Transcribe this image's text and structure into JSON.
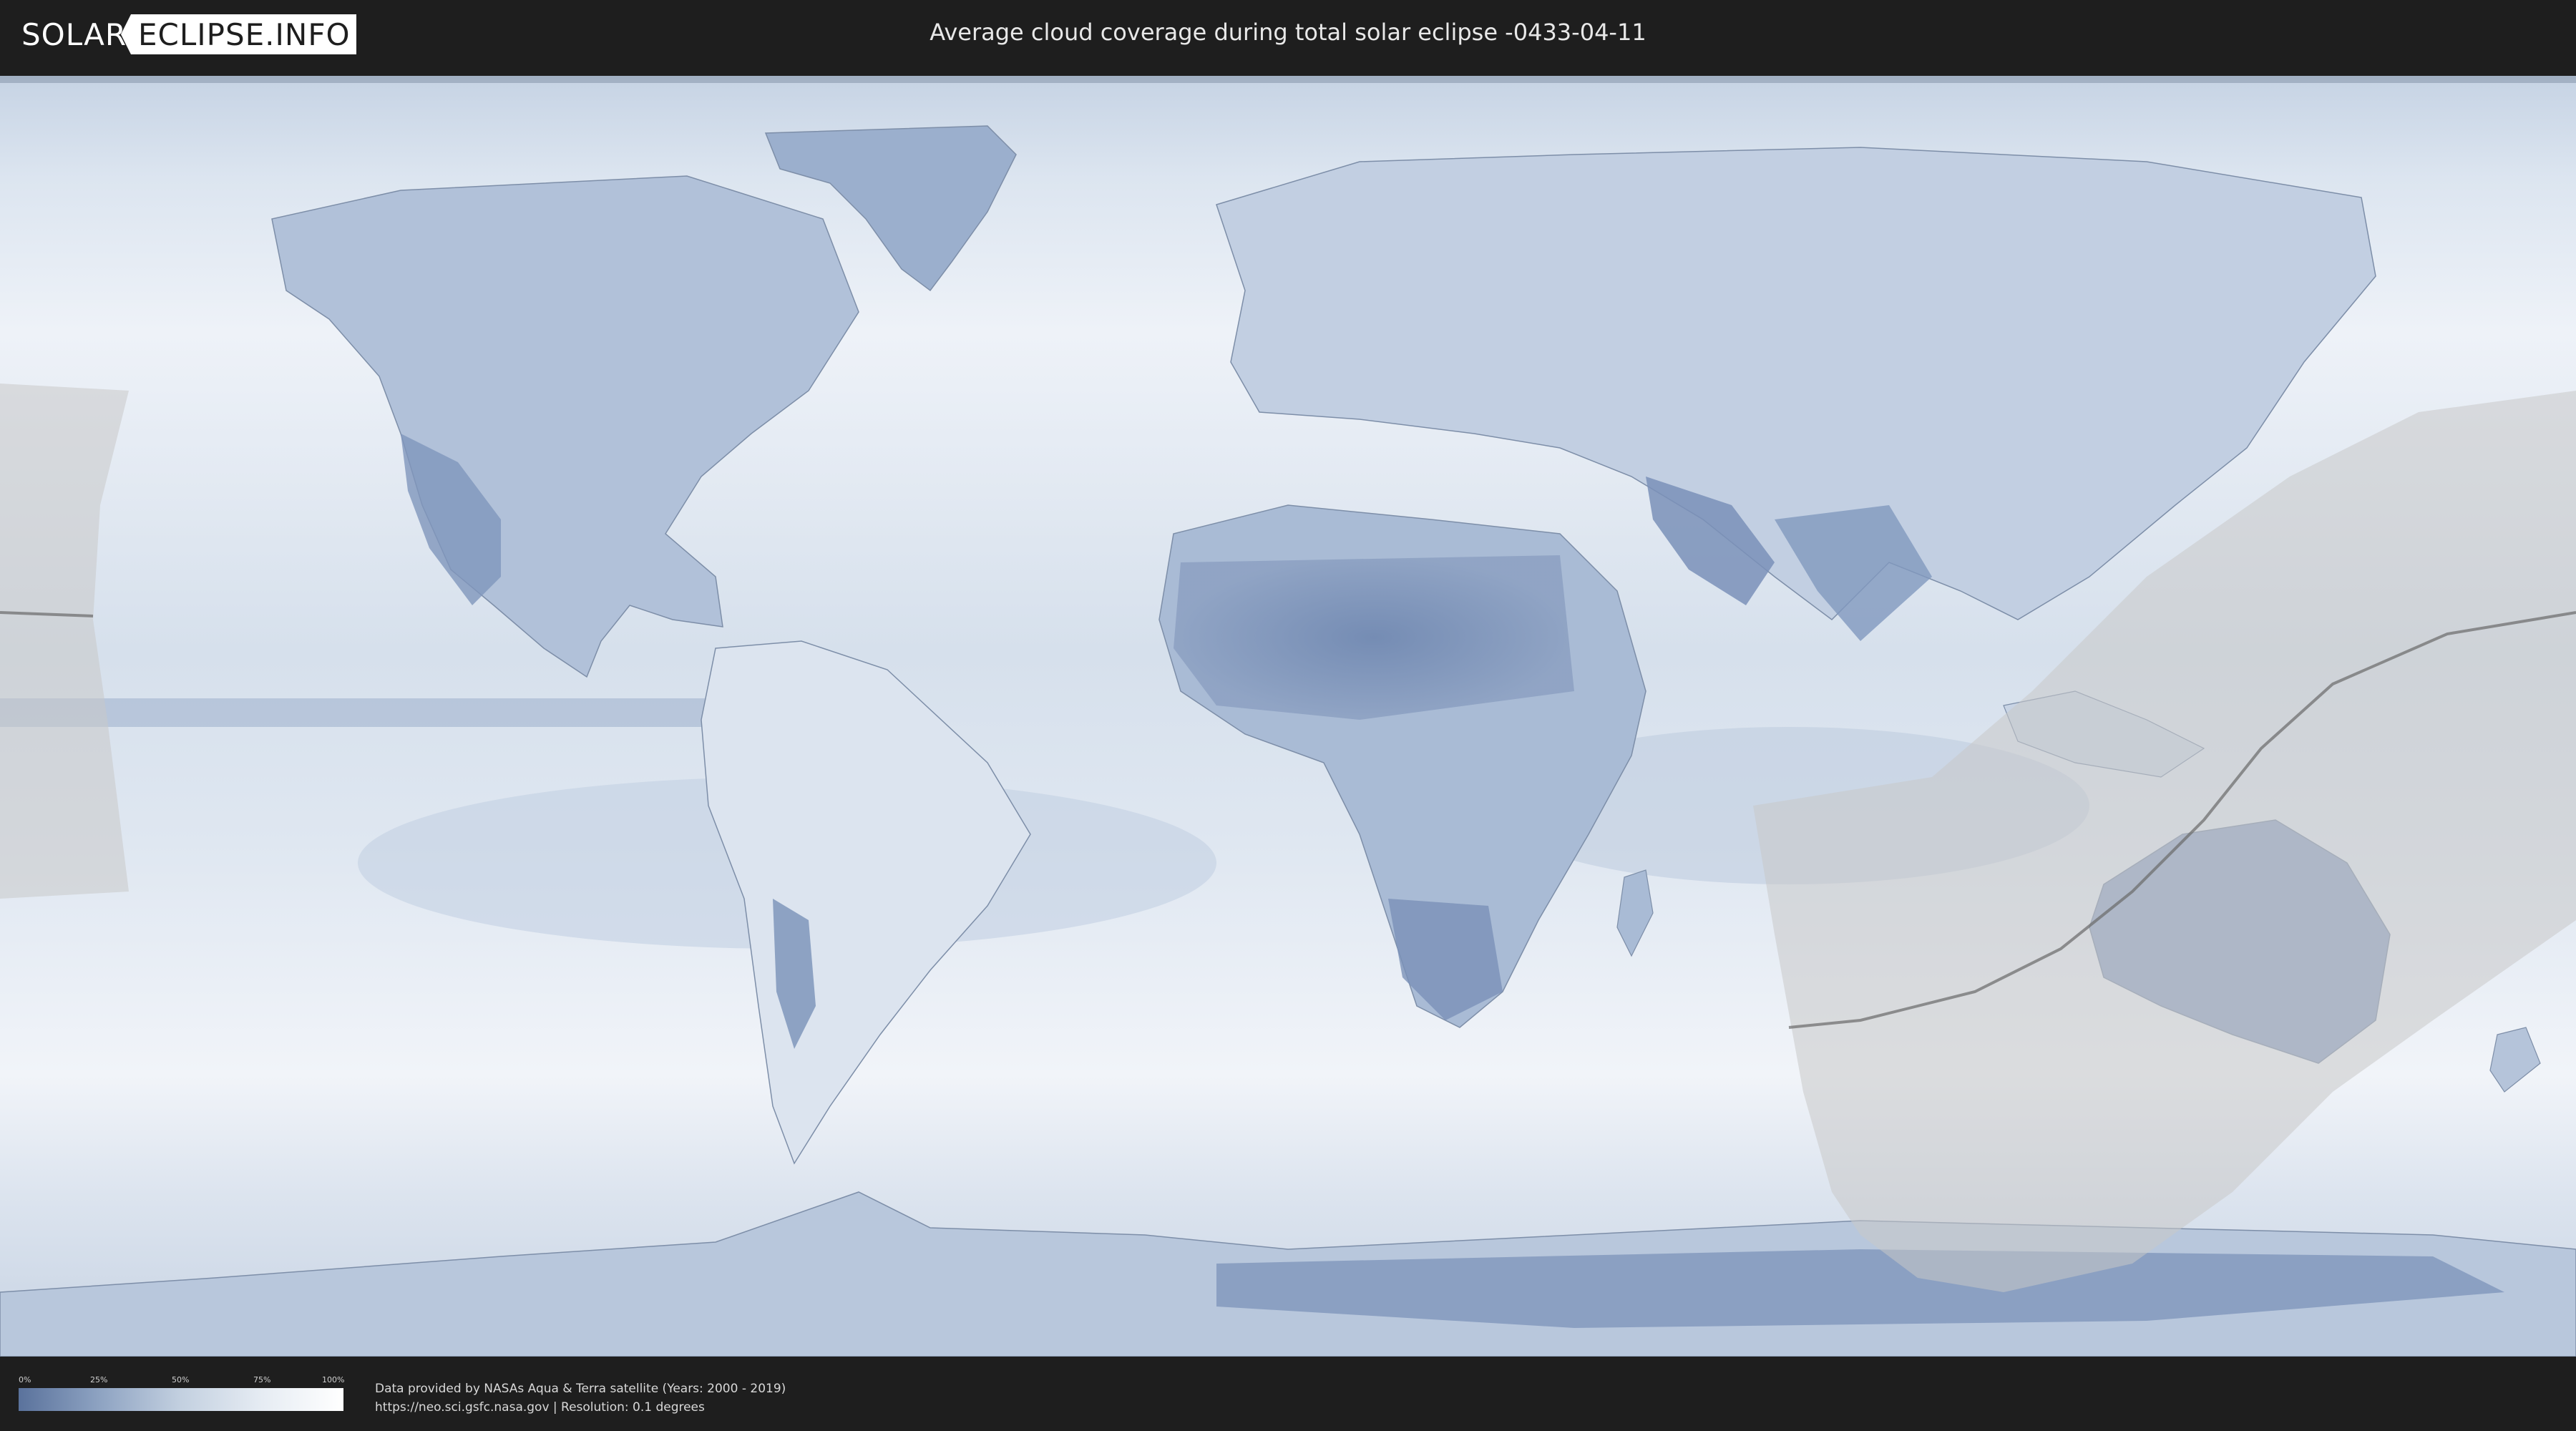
{
  "header": {
    "logo_part1": "SOLAR",
    "logo_part2": "ECLIPSE.INFO",
    "title": "Average cloud coverage during total solar eclipse -0433-04-11"
  },
  "legend": {
    "ticks": [
      "0%",
      "25%",
      "50%",
      "75%",
      "100%"
    ],
    "gradient_colors": [
      "#5a729c",
      "#8ea3c2",
      "#c3d0e0",
      "#e6ecf3",
      "#ffffff"
    ]
  },
  "footer": {
    "credit_line1": "Data provided by NASAs Aqua & Terra satellite (Years: 2000 - 2019)",
    "credit_line2": "https://neo.sci.gsfc.nasa.gov | Resolution: 0.1 degrees"
  },
  "colors": {
    "background": "#1e1e1e",
    "ocean_clear": "#eaf0f7",
    "cloud_low": "#6b84ad",
    "eclipse_shadow": "#c9c9c9"
  }
}
